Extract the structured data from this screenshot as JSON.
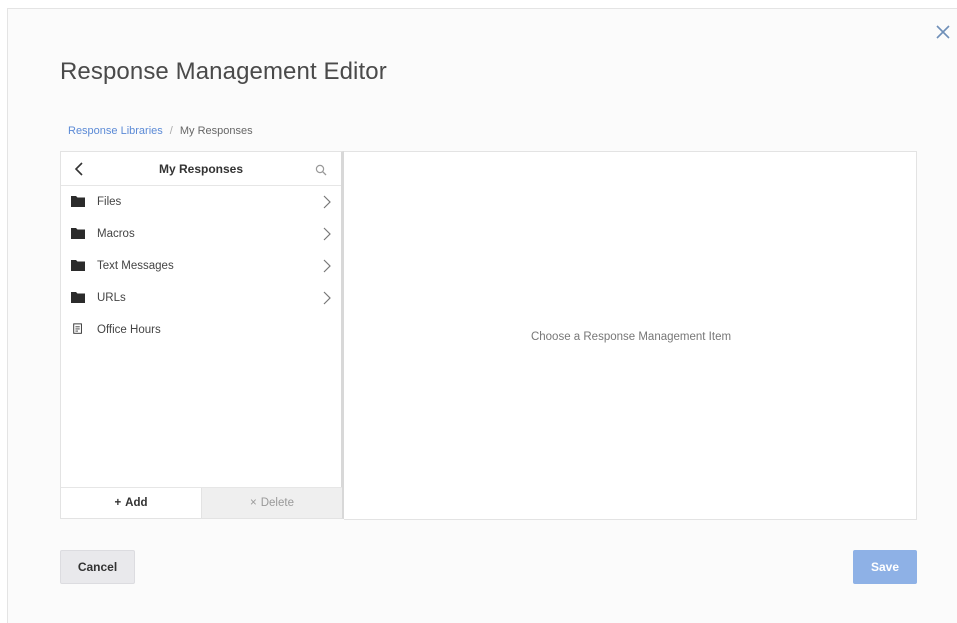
{
  "dialog": {
    "title": "Response Management Editor",
    "close_icon": "close-icon"
  },
  "breadcrumb": {
    "items": [
      {
        "label": "Response Libraries",
        "link": true
      },
      {
        "label": "My Responses",
        "link": false
      }
    ],
    "separator": "/"
  },
  "left_panel": {
    "header": {
      "title": "My Responses",
      "back_icon": "chevron-left-icon",
      "search_icon": "search-icon"
    },
    "items": [
      {
        "label": "Files",
        "icon": "folder-icon",
        "has_children": true
      },
      {
        "label": "Macros",
        "icon": "folder-icon",
        "has_children": true
      },
      {
        "label": "Text Messages",
        "icon": "folder-icon",
        "has_children": true
      },
      {
        "label": "URLs",
        "icon": "folder-icon",
        "has_children": true
      },
      {
        "label": "Office Hours",
        "icon": "document-icon",
        "has_children": false
      }
    ],
    "footer": {
      "add_label": "Add",
      "delete_label": "Delete"
    }
  },
  "right_panel": {
    "placeholder": "Choose a Response Management Item"
  },
  "actions": {
    "cancel_label": "Cancel",
    "save_label": "Save"
  },
  "colors": {
    "link": "#5b8ad6",
    "save_button": "#8eb1e6",
    "cancel_button": "#e9e9ec",
    "delete_bg": "#efefef"
  }
}
